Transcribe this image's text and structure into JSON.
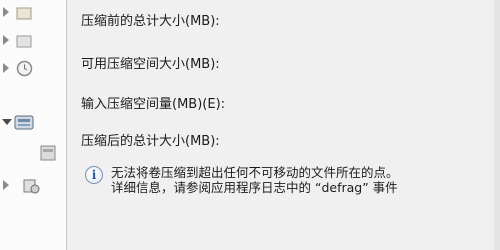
{
  "tree": {
    "items": [
      {
        "state": "collapsed",
        "icon": "folder-icon"
      },
      {
        "state": "collapsed",
        "icon": "folder-icon"
      },
      {
        "state": "collapsed",
        "icon": "clock-icon"
      },
      {
        "state": "expanded",
        "icon": "storage-icon"
      },
      {
        "state": "none",
        "icon": "disk-icon"
      },
      {
        "state": "collapsed",
        "icon": "services-icon"
      }
    ]
  },
  "dialog": {
    "total_before_label": "压缩前的总计大小(MB):",
    "available_label": "可用压缩空间大小(MB):",
    "amount_label": "输入压缩空间量(MB)(E):",
    "total_after_label": "压缩后的总计大小(MB):",
    "notice_line1": "无法将卷压缩到超出任何不可移动的文件所在的点。",
    "notice_line2": "详细信息，请参阅应用程序日志中的 “defrag” 事件",
    "info_icon": "i"
  },
  "colors": {
    "dialog_bg": "#f0f0f0",
    "tree_bg": "#fbfbfb",
    "info_accent": "#2b5aa0"
  }
}
